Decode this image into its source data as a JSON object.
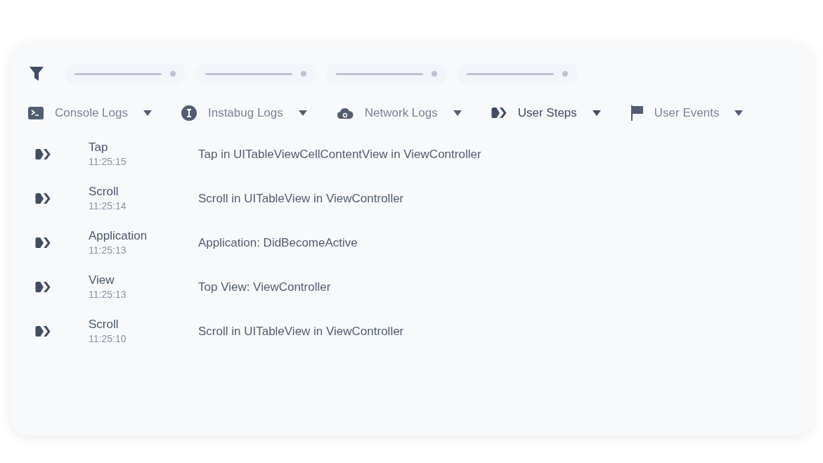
{
  "tabs": [
    {
      "label": "Console Logs",
      "kind": "console",
      "selected": false
    },
    {
      "label": "Instabug Logs",
      "kind": "info",
      "selected": false
    },
    {
      "label": "Network Logs",
      "kind": "cloud",
      "selected": false
    },
    {
      "label": "User Steps",
      "kind": "steps",
      "selected": true
    },
    {
      "label": "User Events",
      "kind": "flag",
      "selected": false
    }
  ],
  "steps": [
    {
      "type": "Tap",
      "time": "11:25:15",
      "message": "Tap in UITableViewCellContentView in ViewController"
    },
    {
      "type": "Scroll",
      "time": "11:25:14",
      "message": "Scroll in UITableView in ViewController"
    },
    {
      "type": "Application",
      "time": "11:25:13",
      "message": "Application: DidBecomeActive"
    },
    {
      "type": "View",
      "time": "11:25:13",
      "message": "Top View: ViewController"
    },
    {
      "type": "Scroll",
      "time": "11:25:10",
      "message": "Scroll in UITableView in ViewController"
    }
  ]
}
